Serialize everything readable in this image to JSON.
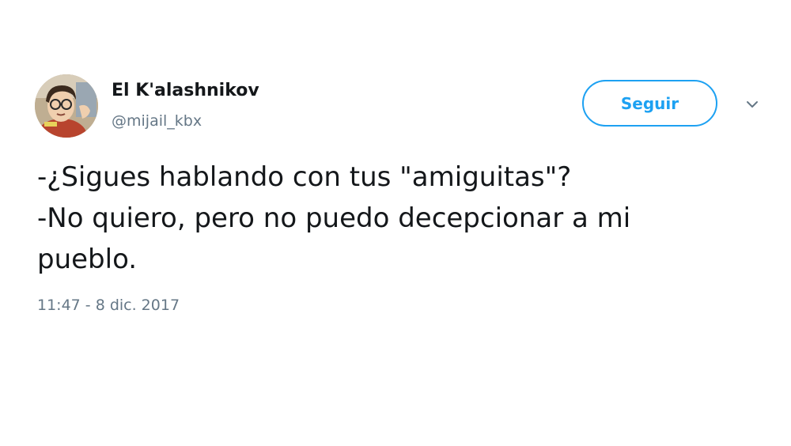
{
  "author": {
    "display_name": "El K'alashnikov",
    "handle": "@mijail_kbx",
    "avatar_icon": "cartoon-character-avatar"
  },
  "actions": {
    "follow_label": "Seguir",
    "more_icon": "chevron-down-icon"
  },
  "tweet": {
    "lines": [
      "-¿Sigues hablando con tus \"amiguitas\"?",
      "-No quiero, pero no puedo decepcionar a mi",
      "pueblo."
    ],
    "timestamp": "11:47 - 8 dic. 2017"
  },
  "colors": {
    "accent": "#1da1f2",
    "text": "#14171a",
    "secondary": "#657786",
    "background": "#ffffff"
  }
}
